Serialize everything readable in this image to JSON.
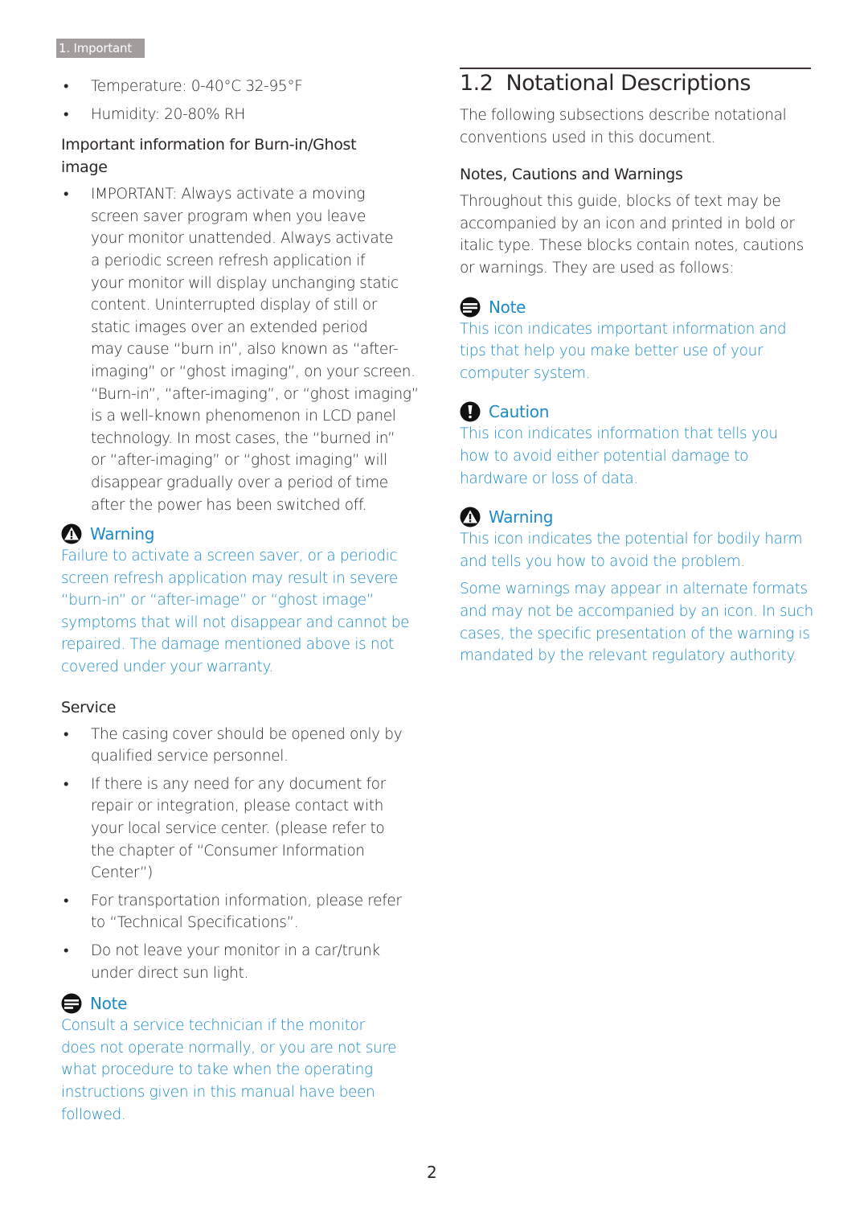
{
  "header": {
    "section_tab": "1. Important"
  },
  "left": {
    "env_bullets": [
      "Temperature: 0-40°C 32-95°F",
      "Humidity: 20-80% RH"
    ],
    "burnin_heading_line1": "Important information for Burn-in/Ghost",
    "burnin_heading_line2": "image",
    "burnin_bullet_lines": [
      "IMPORTANT: Always activate a moving",
      "screen saver program when you leave",
      "your monitor unattended. Always activate",
      "a periodic screen refresh application if",
      "your monitor will display unchanging static",
      "content. Uninterrupted display of still or",
      "static images over an extended period",
      "may cause “burn in”, also known as “after-",
      "imaging” or “ghost imaging”, on your screen.",
      "“Burn-in”, “after-imaging”, or “ghost imaging”",
      "is a well-known phenomenon in LCD panel",
      "technology. In most cases, the “burned in”",
      "or “after-imaging” or “ghost imaging” will",
      "disappear gradually over a period of time",
      "after the power has been switched off."
    ],
    "warning": {
      "label": "Warning",
      "icon": "warning-triangle-icon",
      "lines": [
        "Failure to activate a screen saver, or a periodic",
        "screen refresh application may result in severe",
        "“burn-in” or “after-image” or “ghost image”",
        "symptoms that will not disappear and cannot be",
        "repaired. The damage mentioned above is not",
        "covered under your warranty."
      ]
    },
    "service_heading": "Service",
    "service_bullets": [
      [
        "The casing cover should be opened only by",
        "qualified service personnel."
      ],
      [
        "If there is any need for any document for",
        "repair or integration, please contact with",
        "your local service center. (please refer to",
        "the chapter of “Consumer Information",
        "Center”)"
      ],
      [
        "For transportation information, please refer",
        "to “Technical Specifications”."
      ],
      [
        "Do not leave your monitor in a car/trunk",
        "under direct sun light."
      ]
    ],
    "note": {
      "label": "Note",
      "icon": "note-icon",
      "lines": [
        "Consult a service technician if the monitor",
        "does not operate normally, or you are not sure",
        "what procedure to take when the operating",
        "instructions given in this manual have been",
        "followed."
      ]
    }
  },
  "right": {
    "section_number": "1.2",
    "section_title": "Notational Descriptions",
    "intro_lines": [
      "The following subsections describe notational",
      "conventions used in this document."
    ],
    "subheading": "Notes, Cautions and Warnings",
    "body_lines": [
      "Throughout this guide, blocks of text may be",
      "accompanied by an icon and printed in bold or",
      "italic type. These blocks contain notes, cautions",
      "or warnings. They are used as follows:"
    ],
    "note": {
      "label": "Note",
      "icon": "note-icon",
      "lines": [
        "This icon indicates important information and",
        "tips that help you make better use of your",
        "computer system."
      ]
    },
    "caution": {
      "label": "Caution",
      "icon": "caution-exclamation-icon",
      "lines": [
        "This icon indicates information that tells you",
        "how to avoid either potential damage to",
        "hardware or loss of data."
      ]
    },
    "warning": {
      "label": "Warning",
      "icon": "warning-triangle-icon",
      "lines": [
        "This icon indicates the potential for bodily harm",
        "and tells you how to avoid the problem."
      ]
    },
    "alt_warning_lines": [
      "Some warnings may appear in alternate formats",
      "and may not be accompanied by an icon. In such",
      "cases, the specific presentation of the warning is",
      "mandated by the relevant regulatory authority."
    ]
  },
  "footer": {
    "page_number": "2"
  },
  "colors": {
    "accent_blue": "#1a8ac8",
    "tab_gray": "#a29c9c",
    "text": "#2a2526"
  }
}
